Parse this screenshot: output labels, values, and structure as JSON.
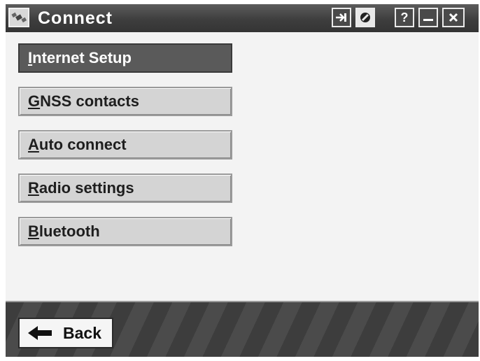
{
  "window": {
    "title": "Connect",
    "app_icon": "satellite-icon",
    "controls": [
      {
        "name": "sync-icon",
        "glyph": "→"
      },
      {
        "name": "disconnect-icon",
        "glyph": "⊘"
      },
      {
        "name": "help-icon",
        "glyph": "?"
      },
      {
        "name": "minimize-icon",
        "glyph": "–"
      },
      {
        "name": "close-icon",
        "glyph": "✕"
      }
    ]
  },
  "menu": {
    "items": [
      {
        "label_first": "I",
        "label_rest": "nternet Setup",
        "selected": true
      },
      {
        "label_first": "G",
        "label_rest": "NSS contacts",
        "selected": false
      },
      {
        "label_first": "A",
        "label_rest": "uto connect",
        "selected": false
      },
      {
        "label_first": "R",
        "label_rest": "adio settings",
        "selected": false
      },
      {
        "label_first": "B",
        "label_rest": "luetooth",
        "selected": false
      }
    ]
  },
  "footer": {
    "back_label": "Back",
    "back_icon": "arrow-left-icon"
  },
  "colors": {
    "titlebar": "#3e3e3e",
    "selected": "#5a5a5a",
    "button": "#d4d4d4"
  }
}
